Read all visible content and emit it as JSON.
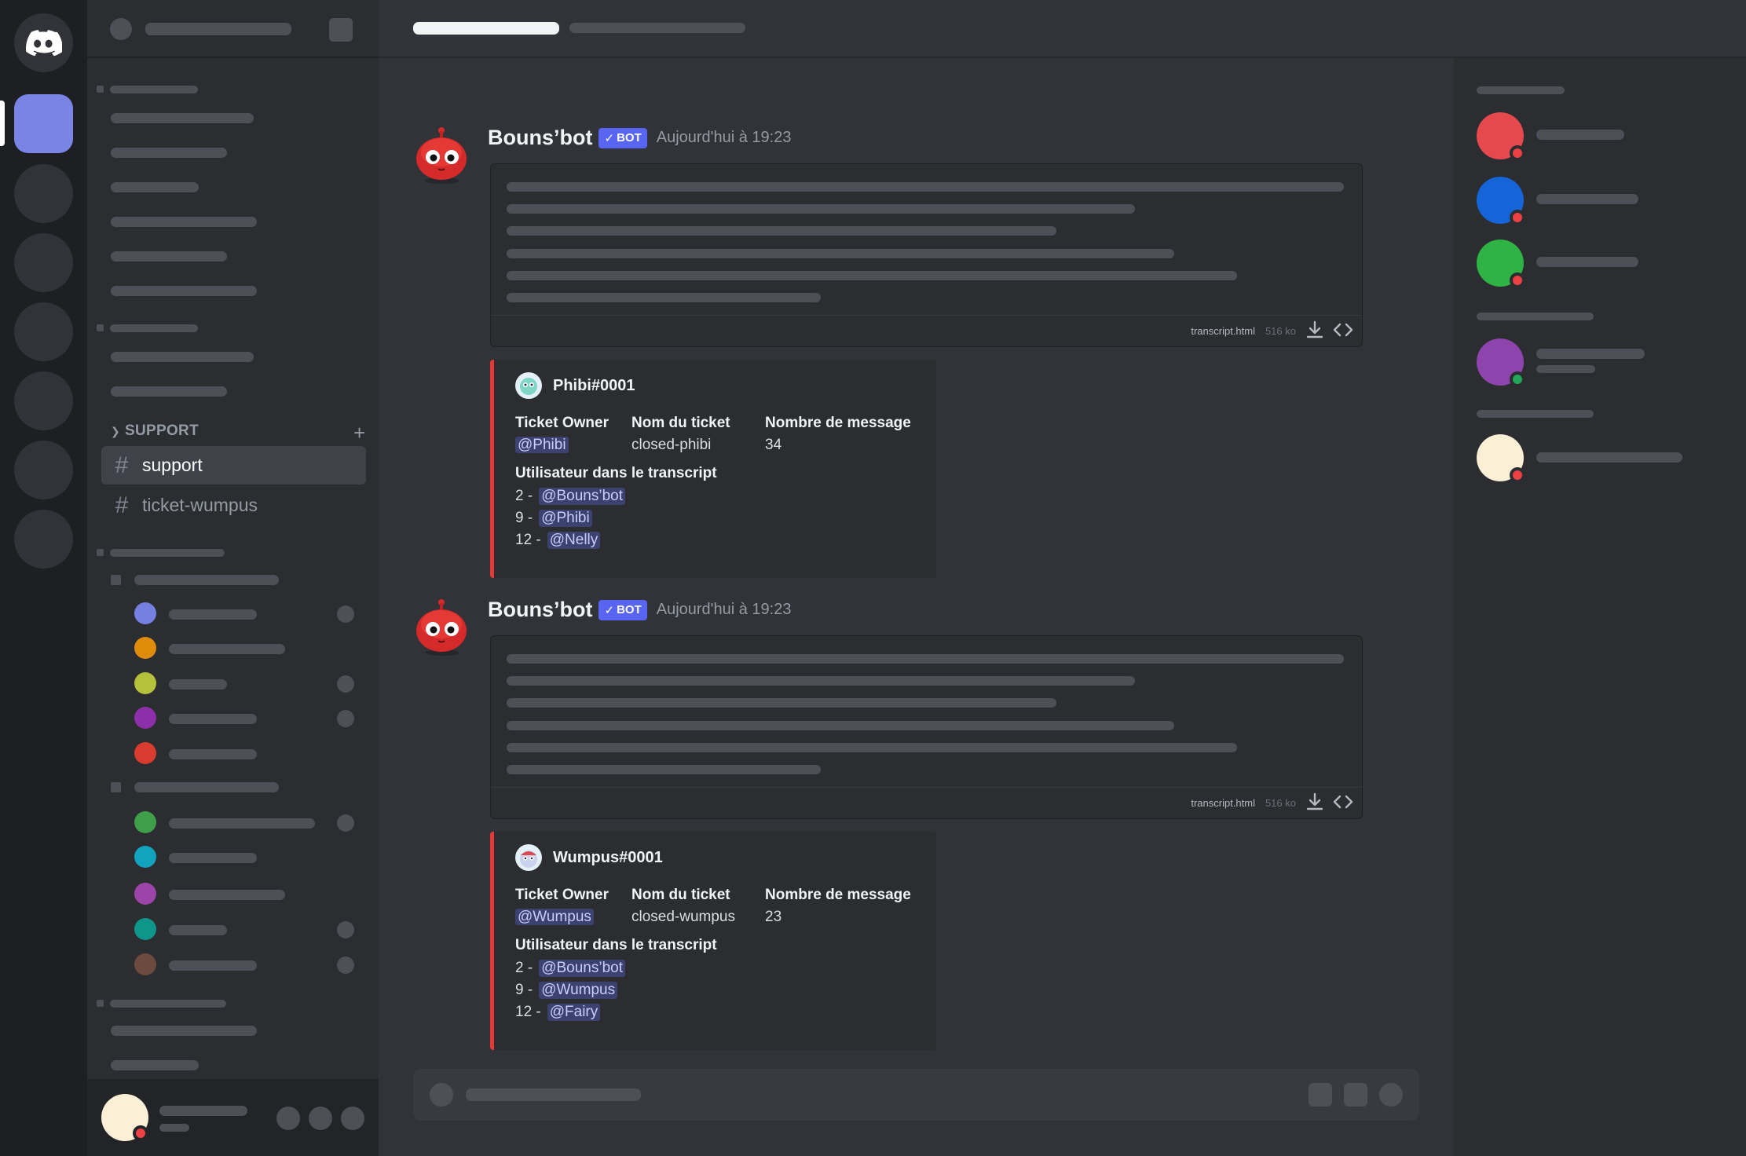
{
  "message_1": {
    "author": "Bouns’bot",
    "badge": "BOT",
    "timestamp": "Aujourd'hui à 19:23",
    "attachment": {
      "filename": "transcript.html",
      "size": "516 ko",
      "download_icon": "download-icon",
      "code_icon": "code-icon"
    },
    "embed": {
      "author": "Phibi#0001",
      "fields": [
        {
          "label": "Ticket Owner",
          "value": "@Phibi",
          "mention": true
        },
        {
          "label": "Nom du ticket",
          "value": "closed-phibi",
          "mention": false
        },
        {
          "label": "Nombre de message",
          "value": "34",
          "mention": false
        }
      ],
      "users_title": "Utilisateur dans le transcript",
      "users": [
        {
          "count": "2 -",
          "name": "@Bouns’bot"
        },
        {
          "count": "9 -",
          "name": "@Phibi"
        },
        {
          "count": "12 -",
          "name": "@Nelly"
        }
      ],
      "accent": "#e53935"
    }
  },
  "message_2": {
    "author": "Bouns’bot",
    "badge": "BOT",
    "timestamp": "Aujourd'hui à 19:23",
    "attachment": {
      "filename": "transcript.html",
      "size": "516 ko",
      "download_icon": "download-icon",
      "code_icon": "code-icon"
    },
    "embed": {
      "author": "Wumpus#0001",
      "fields": [
        {
          "label": "Ticket Owner",
          "value": "@Wumpus",
          "mention": true
        },
        {
          "label": "Nom du ticket",
          "value": "closed-wumpus",
          "mention": false
        },
        {
          "label": "Nombre de message",
          "value": "23",
          "mention": false
        }
      ],
      "users_title": "Utilisateur dans le transcript",
      "users": [
        {
          "count": "2 -",
          "name": "@Bouns’bot"
        },
        {
          "count": "9 -",
          "name": "@Wumpus"
        },
        {
          "count": "12 -",
          "name": "@Fairy"
        }
      ],
      "accent": "#e53935"
    }
  },
  "sidebar": {
    "category": "SUPPORT",
    "channels": [
      {
        "name": "support",
        "selected": true
      },
      {
        "name": "ticket-wumpus",
        "selected": false
      }
    ]
  },
  "colors": {
    "blurple": "#5865f2",
    "server_active": "#7984e4",
    "status_dnd": "#ed4245",
    "status_online": "#23a55a",
    "member_avatars": [
      "#e5484d",
      "#1565d8",
      "#2fb344",
      "#8e44ad",
      "#fbefd6"
    ]
  }
}
